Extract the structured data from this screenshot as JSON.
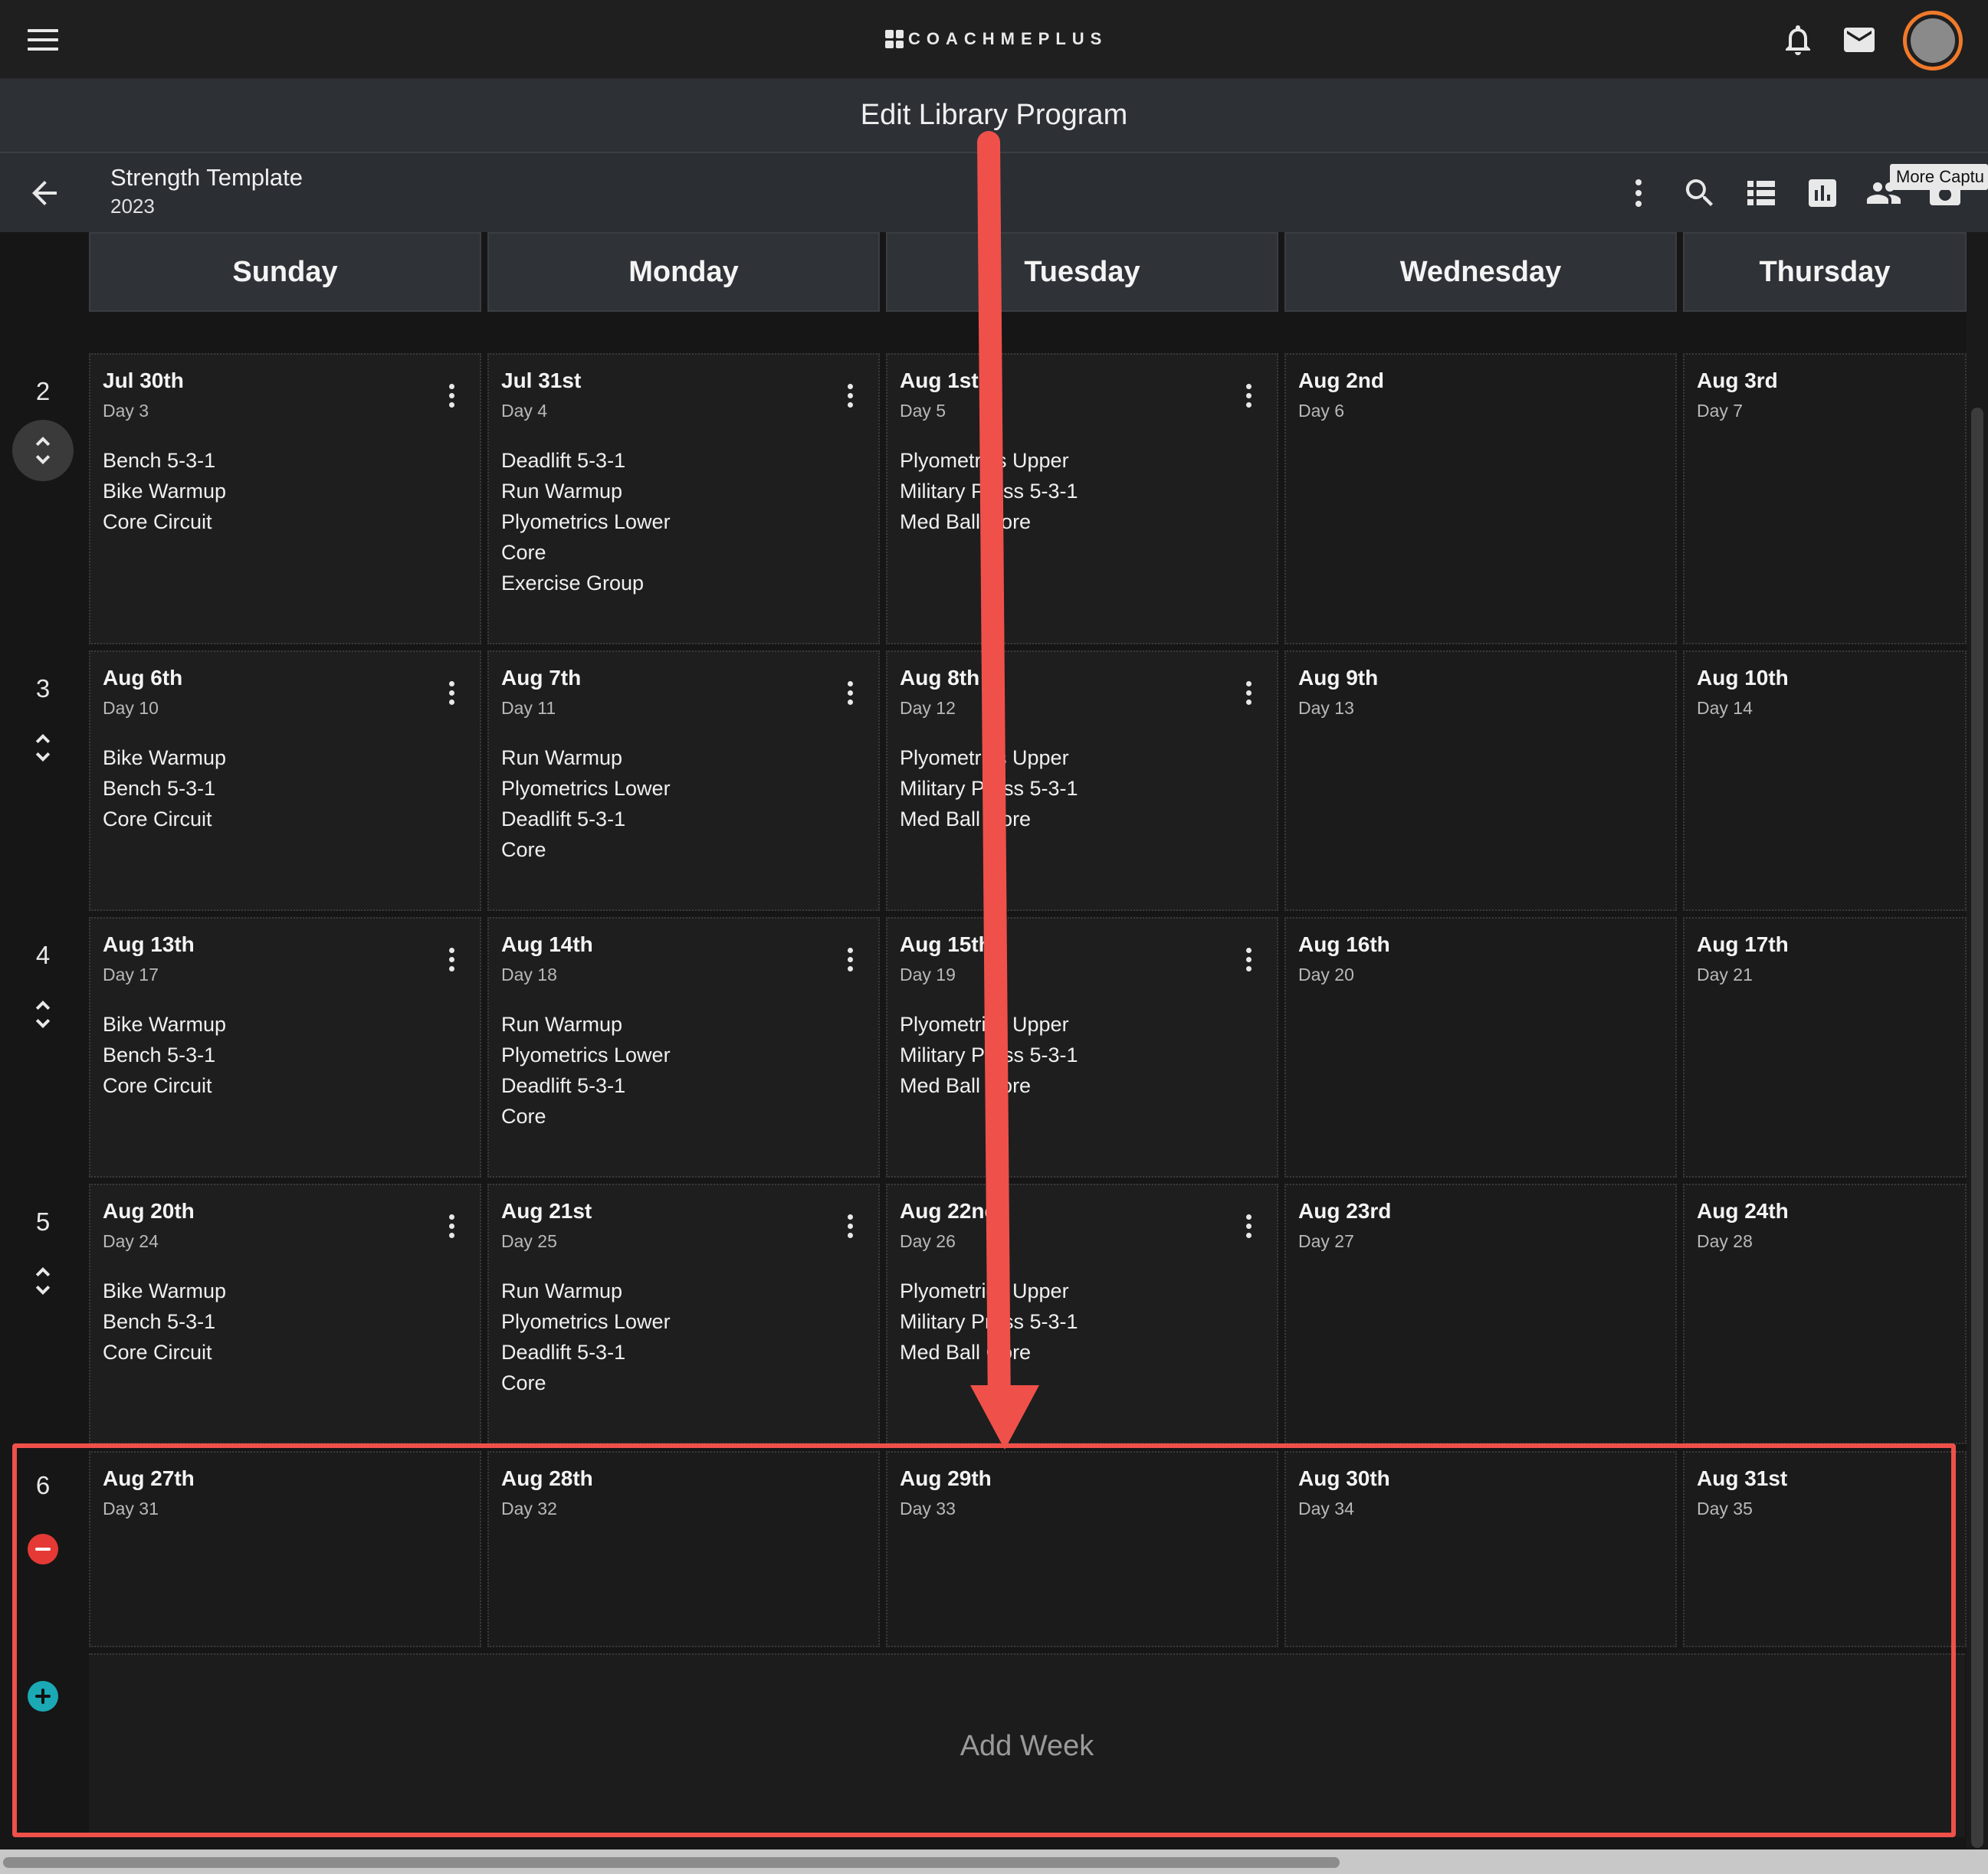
{
  "app": {
    "brand": "COACHMEPLUS",
    "page_title": "Edit Library Program",
    "tooltip": "More Captu"
  },
  "program": {
    "name": "Strength Template",
    "year": "2023"
  },
  "days": [
    "Sunday",
    "Monday",
    "Tuesday",
    "Wednesday",
    "Thursday"
  ],
  "weeks": [
    {
      "number": "2",
      "cells": [
        {
          "date": "Jul 30th",
          "day": "Day 3",
          "items": [
            "Bench 5-3-1",
            "Bike Warmup",
            "Core Circuit"
          ]
        },
        {
          "date": "Jul 31st",
          "day": "Day 4",
          "items": [
            "Deadlift 5-3-1",
            "Run Warmup",
            "Plyometrics Lower",
            "Core",
            "Exercise Group"
          ]
        },
        {
          "date": "Aug 1st",
          "day": "Day 5",
          "items": [
            "Plyometrics Upper",
            "Military Press 5-3-1",
            "Med Ball Core"
          ]
        },
        {
          "date": "Aug 2nd",
          "day": "Day 6",
          "items": []
        },
        {
          "date": "Aug 3rd",
          "day": "Day 7",
          "items": []
        }
      ]
    },
    {
      "number": "3",
      "cells": [
        {
          "date": "Aug 6th",
          "day": "Day 10",
          "items": [
            "Bike Warmup",
            "Bench 5-3-1",
            "Core Circuit"
          ]
        },
        {
          "date": "Aug 7th",
          "day": "Day 11",
          "items": [
            "Run Warmup",
            "Plyometrics Lower",
            "Deadlift 5-3-1",
            "Core"
          ]
        },
        {
          "date": "Aug 8th",
          "day": "Day 12",
          "items": [
            "Plyometrics Upper",
            "Military Press 5-3-1",
            "Med Ball Core"
          ]
        },
        {
          "date": "Aug 9th",
          "day": "Day 13",
          "items": []
        },
        {
          "date": "Aug 10th",
          "day": "Day 14",
          "items": []
        }
      ]
    },
    {
      "number": "4",
      "cells": [
        {
          "date": "Aug 13th",
          "day": "Day 17",
          "items": [
            "Bike Warmup",
            "Bench 5-3-1",
            "Core Circuit"
          ]
        },
        {
          "date": "Aug 14th",
          "day": "Day 18",
          "items": [
            "Run Warmup",
            "Plyometrics Lower",
            "Deadlift 5-3-1",
            "Core"
          ]
        },
        {
          "date": "Aug 15th",
          "day": "Day 19",
          "items": [
            "Plyometrics Upper",
            "Military Press 5-3-1",
            "Med Ball Core"
          ]
        },
        {
          "date": "Aug 16th",
          "day": "Day 20",
          "items": []
        },
        {
          "date": "Aug 17th",
          "day": "Day 21",
          "items": []
        }
      ]
    },
    {
      "number": "5",
      "cells": [
        {
          "date": "Aug 20th",
          "day": "Day 24",
          "items": [
            "Bike Warmup",
            "Bench 5-3-1",
            "Core Circuit"
          ]
        },
        {
          "date": "Aug 21st",
          "day": "Day 25",
          "items": [
            "Run Warmup",
            "Plyometrics Lower",
            "Deadlift 5-3-1",
            "Core"
          ]
        },
        {
          "date": "Aug 22nd",
          "day": "Day 26",
          "items": [
            "Plyometrics Upper",
            "Military Press 5-3-1",
            "Med Ball Core"
          ]
        },
        {
          "date": "Aug 23rd",
          "day": "Day 27",
          "items": []
        },
        {
          "date": "Aug 24th",
          "day": "Day 28",
          "items": []
        }
      ]
    },
    {
      "number": "6",
      "cells": [
        {
          "date": "Aug 27th",
          "day": "Day 31",
          "items": []
        },
        {
          "date": "Aug 28th",
          "day": "Day 32",
          "items": []
        },
        {
          "date": "Aug 29th",
          "day": "Day 33",
          "items": []
        },
        {
          "date": "Aug 30th",
          "day": "Day 34",
          "items": []
        },
        {
          "date": "Aug 31st",
          "day": "Day 35",
          "items": []
        }
      ]
    }
  ],
  "add_week_label": "Add Week",
  "colors": {
    "accent_orange": "#f07a2a",
    "annotation_red": "#f0504a",
    "remove_red": "#e53935",
    "add_teal": "#1aa9b5"
  }
}
